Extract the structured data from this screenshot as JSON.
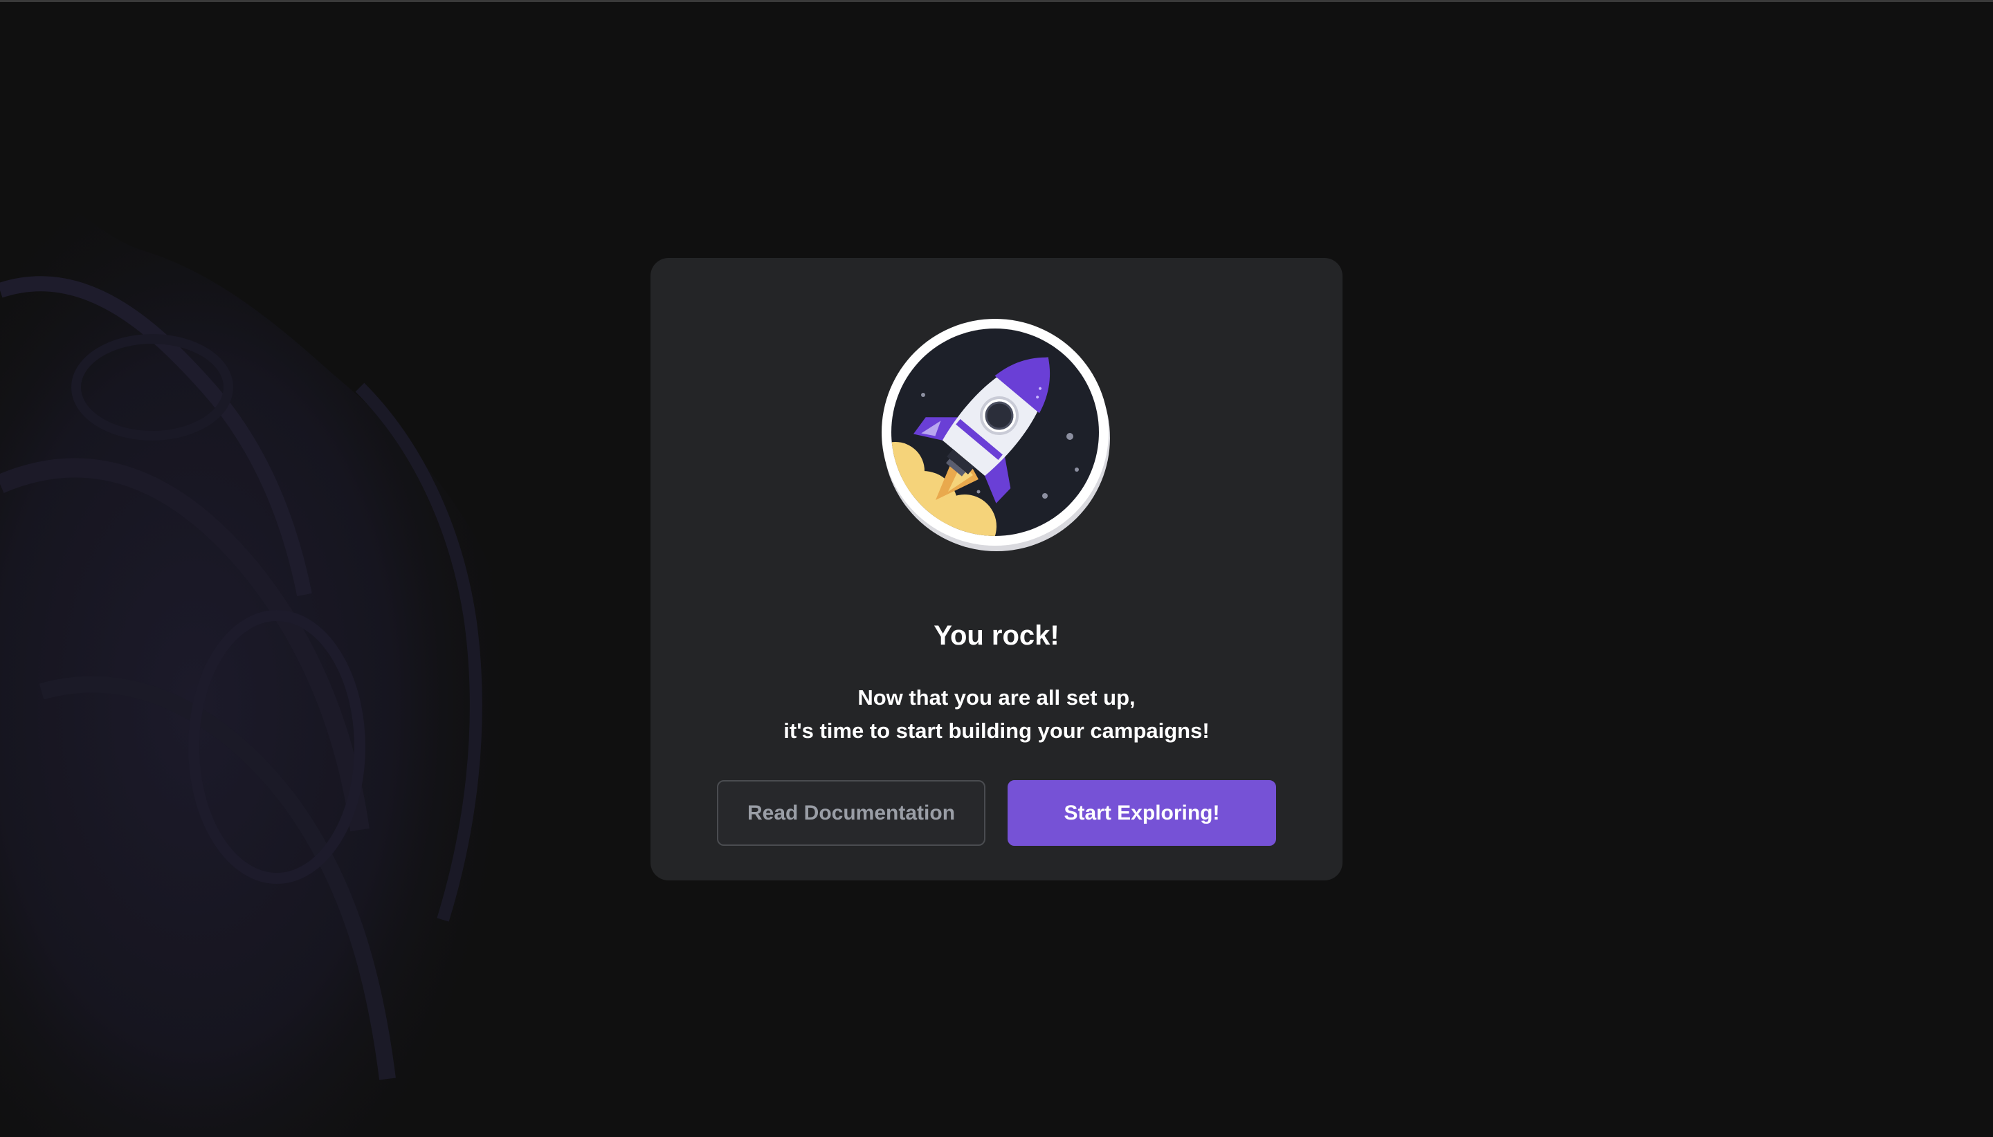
{
  "modal": {
    "title": "You rock!",
    "subtitle_line1": "Now that you are all set up,",
    "subtitle_line2": "it's time to start building your campaigns!",
    "secondary_button_label": "Read Documentation",
    "primary_button_label": "Start Exploring!",
    "illustration_icon": "rocket-launch-icon"
  },
  "colors": {
    "background": "#101010",
    "card": "#242527",
    "primary_button": "#7652d6",
    "secondary_button_text": "#9a9ea6",
    "rocket_purple": "#6a3fd6",
    "flame_yellow": "#f5d37a"
  }
}
